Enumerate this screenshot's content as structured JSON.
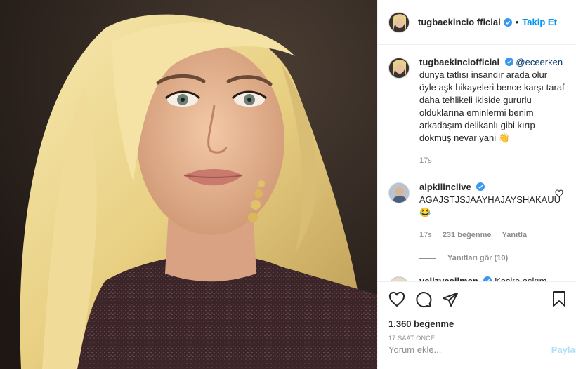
{
  "header": {
    "username": "tugbaekincio fficial",
    "follow_label": "Takip Et",
    "dot": "•"
  },
  "caption": {
    "username": "tugbaekinciofficial",
    "mention": "@eceerken",
    "text": "dünya tatlısı insandır arada olur öyle aşk hikayeleri bence karşı taraf daha tehlikeli ikiside gururlu olduklarına eminlermi benim arkadaşım delikanlı gibi kırıp dökmüş nevar yani 👋",
    "time": "17s"
  },
  "comments": [
    {
      "username": "alpkilinclive",
      "text": "AGAJSTJSJAAYHAJAYSHAKAUU 😂",
      "time": "17s",
      "likes": "231 beğenme",
      "reply": "Yanıtla",
      "view_replies": "Yanıtları gör (10)"
    },
    {
      "username": "yelizyesilmen",
      "text": "Keşke aşkım banada haksızlığa uğrayıp iftira atıldığında meslektaşlarım sahip"
    }
  ],
  "actions": {
    "likes": "1.360 beğenme",
    "time": "17 saat önce"
  },
  "add_comment": {
    "placeholder": "Yorum ekle...",
    "share_label": "Paylaş"
  },
  "colors": {
    "accent": "#0095f6",
    "verified": "#3897f0",
    "muted": "#8e8e8e"
  }
}
